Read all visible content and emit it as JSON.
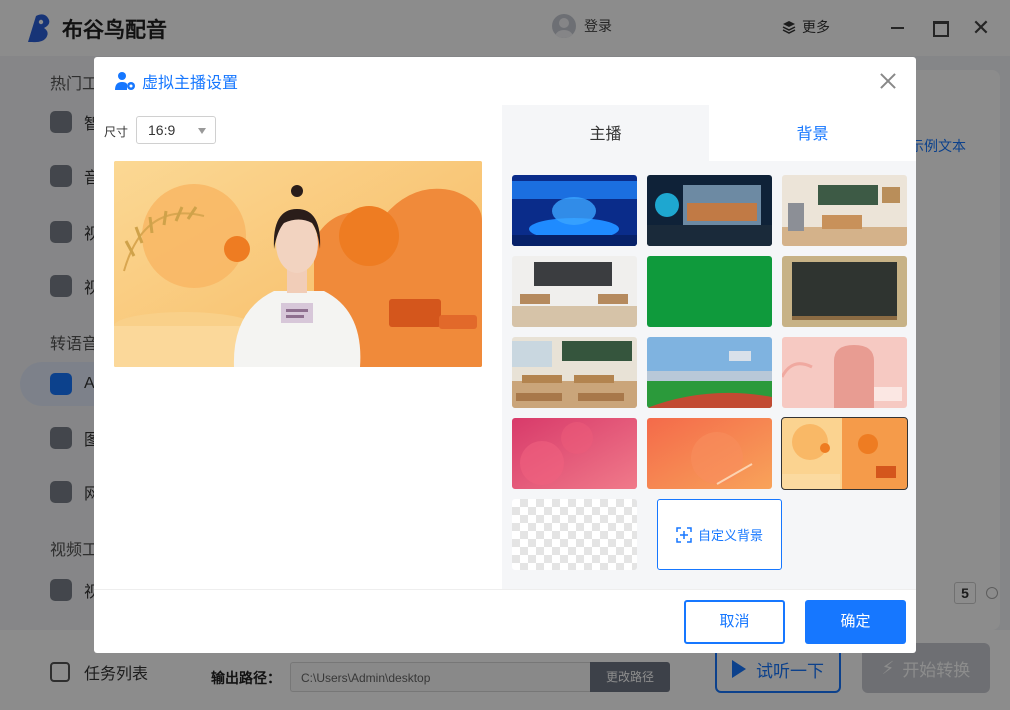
{
  "app": {
    "title": "布谷鸟配音",
    "login_label": "登录",
    "more_label": "更多"
  },
  "sidebar": {
    "sections": [
      {
        "label": "热门工"
      },
      {
        "label": "转语音"
      },
      {
        "label": "视频工"
      }
    ],
    "items": [
      {
        "label": "智",
        "icon": "search-icon"
      },
      {
        "label": "音",
        "icon": "ai-icon"
      },
      {
        "label": "视",
        "icon": "video-ai-icon"
      },
      {
        "label": "视",
        "icon": "audio-icon"
      },
      {
        "label": "A",
        "icon": "avatar-icon"
      },
      {
        "label": "图",
        "icon": "image-icon"
      },
      {
        "label": "网",
        "icon": "web-icon"
      },
      {
        "label": "视",
        "icon": "video-icon"
      }
    ]
  },
  "main": {
    "sample_text": "示例文本",
    "speed_value": "5"
  },
  "bottom": {
    "task_list": "任务列表",
    "output_label": "输出路径：",
    "output_path": "C:\\Users\\Admin\\desktop",
    "change_path": "更改路径",
    "listen": "试听一下",
    "start": "开始转换"
  },
  "dialog": {
    "title": "虚拟主播设置",
    "size_label": "尺寸",
    "size_value": "16:9",
    "tabs": [
      {
        "label": "主播",
        "active": false
      },
      {
        "label": "背景",
        "active": true
      }
    ],
    "backgrounds": [
      {
        "name": "news-studio-blue"
      },
      {
        "name": "news-studio-city"
      },
      {
        "name": "classroom-green-board"
      },
      {
        "name": "classroom-dark"
      },
      {
        "name": "green-screen"
      },
      {
        "name": "blackboard"
      },
      {
        "name": "classroom-desks"
      },
      {
        "name": "stadium"
      },
      {
        "name": "pink-room"
      },
      {
        "name": "pink-gradient"
      },
      {
        "name": "orange-gradient"
      },
      {
        "name": "orange-stage",
        "selected": true
      },
      {
        "name": "transparent"
      }
    ],
    "custom_bg_label": "自定义背景",
    "cancel": "取消",
    "ok": "确定"
  },
  "colors": {
    "accent": "#1677ff",
    "overlay": "rgba(0,0,0,0.45)"
  }
}
